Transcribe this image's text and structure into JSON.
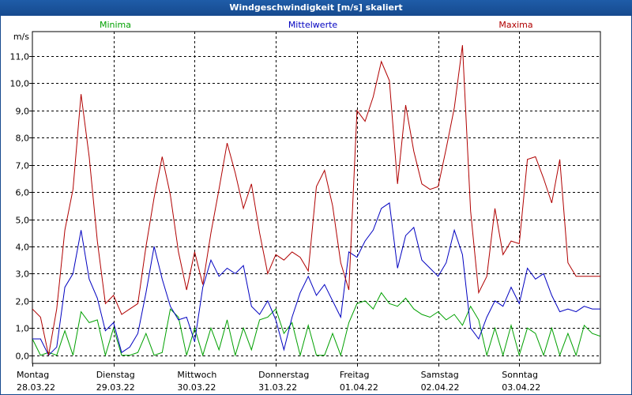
{
  "window": {
    "title": "Windgeschwindigkeit [m/s] skaliert"
  },
  "chart_data": {
    "type": "line",
    "ylabel": "m/s",
    "ylim": [
      -0.3,
      11.9
    ],
    "yticks": [
      "0,0",
      "1,0",
      "2,0",
      "3,0",
      "4,0",
      "5,0",
      "6,0",
      "7,0",
      "8,0",
      "9,0",
      "10,0",
      "11,0"
    ],
    "xlim": [
      0,
      7
    ],
    "day_labels": [
      {
        "day": "Montag",
        "date": "28.03.22"
      },
      {
        "day": "Dienstag",
        "date": "29.03.22"
      },
      {
        "day": "Mittwoch",
        "date": "30.03.22"
      },
      {
        "day": "Donnerstag",
        "date": "31.03.22"
      },
      {
        "day": "Freitag",
        "date": "01.04.22"
      },
      {
        "day": "Samstag",
        "date": "02.04.22"
      },
      {
        "day": "Sonntag",
        "date": "03.04.22"
      }
    ],
    "grid": true,
    "series": [
      {
        "name": "Minima",
        "color": "#00a000",
        "x": [
          0,
          0.1,
          0.2,
          0.3,
          0.4,
          0.5,
          0.6,
          0.7,
          0.8,
          0.9,
          1.0,
          1.1,
          1.2,
          1.3,
          1.4,
          1.5,
          1.6,
          1.7,
          1.8,
          1.9,
          2.0,
          2.1,
          2.2,
          2.3,
          2.4,
          2.5,
          2.6,
          2.7,
          2.8,
          2.9,
          3.0,
          3.1,
          3.2,
          3.3,
          3.4,
          3.5,
          3.6,
          3.7,
          3.8,
          3.9,
          4.0,
          4.1,
          4.2,
          4.3,
          4.4,
          4.5,
          4.6,
          4.7,
          4.8,
          4.9,
          5.0,
          5.1,
          5.2,
          5.3,
          5.4,
          5.5,
          5.6,
          5.7,
          5.8,
          5.9,
          6.0,
          6.1,
          6.2,
          6.3,
          6.4,
          6.5,
          6.6,
          6.7,
          6.8,
          6.9,
          7.0
        ],
        "y": [
          0.6,
          0.0,
          0.1,
          0.0,
          0.9,
          0.0,
          1.6,
          1.2,
          1.3,
          0.0,
          1.0,
          0.0,
          0.0,
          0.1,
          0.8,
          0.0,
          0.1,
          1.7,
          1.4,
          0.0,
          1.0,
          0.0,
          1.0,
          0.2,
          1.3,
          0.0,
          1.0,
          0.2,
          1.3,
          1.4,
          1.7,
          0.8,
          1.2,
          0.0,
          1.1,
          0.0,
          0.0,
          0.8,
          0.0,
          1.2,
          1.9,
          2.0,
          1.7,
          2.3,
          1.9,
          1.8,
          2.1,
          1.7,
          1.5,
          1.4,
          1.6,
          1.3,
          1.5,
          1.1,
          1.8,
          1.3,
          0.0,
          1.0,
          0.0,
          1.1,
          0.0,
          1.0,
          0.8,
          0.0,
          1.0,
          0.0,
          0.8,
          0.0,
          1.1,
          0.8,
          0.7
        ]
      },
      {
        "name": "Mittelwerte",
        "color": "#0000c0",
        "x": [
          0,
          0.1,
          0.2,
          0.3,
          0.4,
          0.5,
          0.6,
          0.7,
          0.8,
          0.9,
          1.0,
          1.1,
          1.2,
          1.3,
          1.4,
          1.5,
          1.6,
          1.7,
          1.8,
          1.9,
          2.0,
          2.1,
          2.2,
          2.3,
          2.4,
          2.5,
          2.6,
          2.7,
          2.8,
          2.9,
          3.0,
          3.1,
          3.2,
          3.3,
          3.4,
          3.5,
          3.6,
          3.7,
          3.8,
          3.9,
          4.0,
          4.1,
          4.2,
          4.3,
          4.4,
          4.5,
          4.6,
          4.7,
          4.8,
          4.9,
          5.0,
          5.1,
          5.2,
          5.3,
          5.4,
          5.5,
          5.6,
          5.7,
          5.8,
          5.9,
          6.0,
          6.1,
          6.2,
          6.3,
          6.4,
          6.5,
          6.6,
          6.7,
          6.8,
          6.9,
          7.0
        ],
        "y": [
          0.6,
          0.6,
          0.0,
          0.3,
          2.5,
          3.0,
          4.6,
          2.8,
          2.1,
          0.9,
          1.2,
          0.1,
          0.3,
          0.8,
          2.3,
          4.0,
          2.8,
          1.8,
          1.3,
          1.4,
          0.5,
          2.5,
          3.5,
          2.9,
          3.2,
          3.0,
          3.3,
          1.8,
          1.5,
          2.0,
          1.3,
          0.2,
          1.4,
          2.3,
          2.9,
          2.2,
          2.6,
          2.0,
          1.4,
          3.8,
          3.6,
          4.2,
          4.6,
          5.4,
          5.6,
          3.2,
          4.4,
          4.7,
          3.5,
          3.2,
          2.9,
          3.4,
          4.6,
          3.7,
          1.0,
          0.6,
          1.4,
          2.0,
          1.8,
          2.5,
          1.9,
          3.2,
          2.8,
          3.0,
          2.2,
          1.6,
          1.7,
          1.6,
          1.8,
          1.7,
          1.7
        ]
      },
      {
        "name": "Maxima",
        "color": "#b00000",
        "x": [
          0,
          0.1,
          0.2,
          0.3,
          0.4,
          0.5,
          0.6,
          0.7,
          0.8,
          0.9,
          1.0,
          1.1,
          1.2,
          1.3,
          1.4,
          1.5,
          1.6,
          1.7,
          1.8,
          1.9,
          2.0,
          2.1,
          2.2,
          2.3,
          2.4,
          2.5,
          2.6,
          2.7,
          2.8,
          2.9,
          3.0,
          3.1,
          3.2,
          3.3,
          3.4,
          3.5,
          3.6,
          3.7,
          3.8,
          3.9,
          4.0,
          4.1,
          4.2,
          4.3,
          4.4,
          4.5,
          4.6,
          4.7,
          4.8,
          4.9,
          5.0,
          5.1,
          5.2,
          5.3,
          5.4,
          5.5,
          5.6,
          5.7,
          5.8,
          5.9,
          6.0,
          6.1,
          6.2,
          6.3,
          6.4,
          6.5,
          6.6,
          6.7,
          6.8,
          6.9,
          7.0
        ],
        "y": [
          1.7,
          1.4,
          0.0,
          1.7,
          4.6,
          6.1,
          9.6,
          7.3,
          4.2,
          1.9,
          2.2,
          1.5,
          1.7,
          1.9,
          4.0,
          5.8,
          7.3,
          5.9,
          3.8,
          2.4,
          3.8,
          2.6,
          4.5,
          6.1,
          7.8,
          6.7,
          5.4,
          6.3,
          4.5,
          3.0,
          3.7,
          3.5,
          3.8,
          3.6,
          3.1,
          6.2,
          6.8,
          5.5,
          3.4,
          2.4,
          9.0,
          8.6,
          9.5,
          10.8,
          10.1,
          6.3,
          9.2,
          7.5,
          6.3,
          6.1,
          6.2,
          7.6,
          9.1,
          11.4,
          5.3,
          2.3,
          2.9,
          5.4,
          3.7,
          4.2,
          4.1,
          7.2,
          7.3,
          6.5,
          5.6,
          7.2,
          3.4,
          2.9,
          2.9,
          2.9,
          2.9
        ]
      }
    ]
  }
}
